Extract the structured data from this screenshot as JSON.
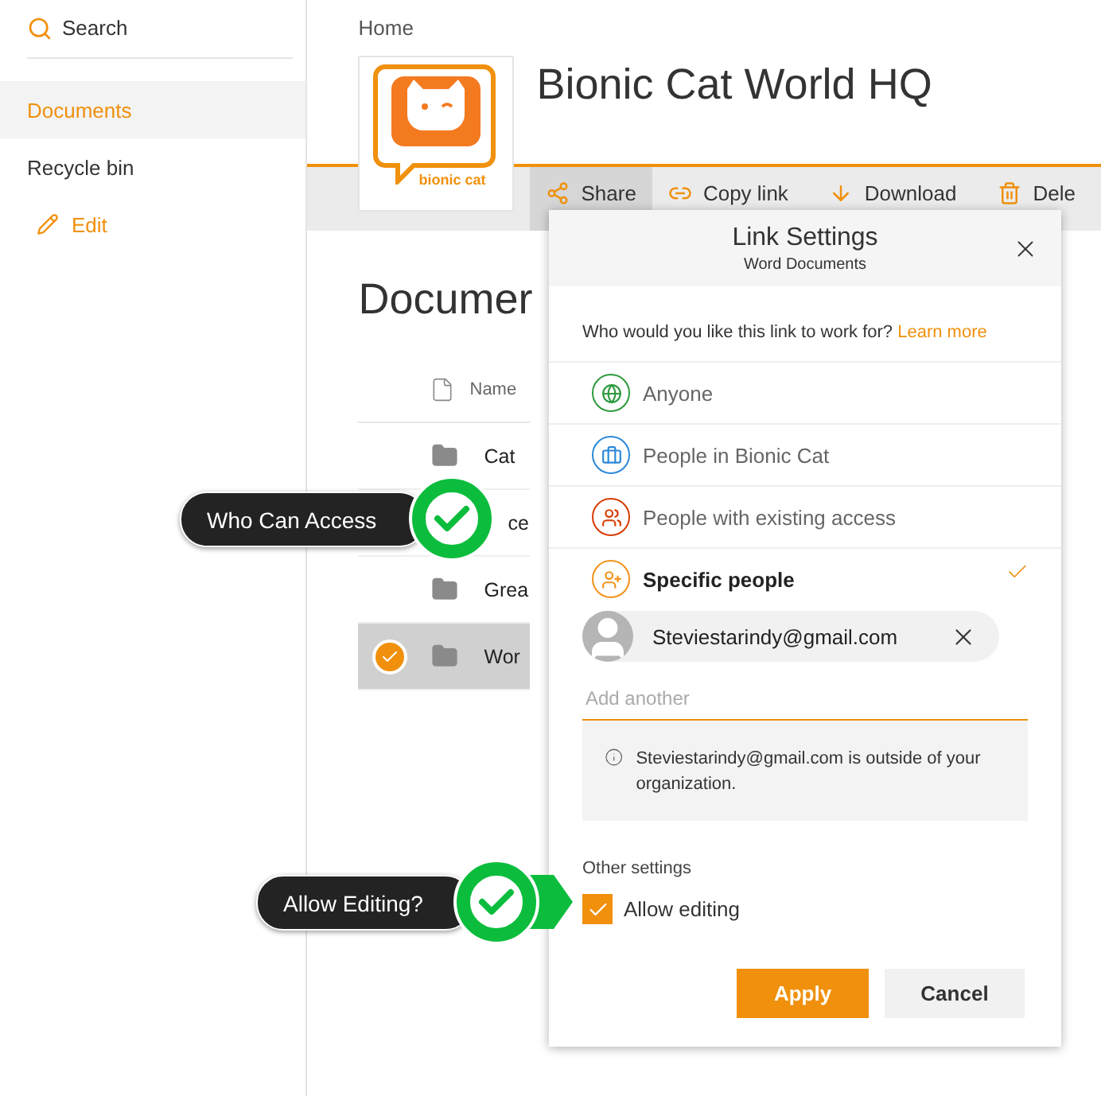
{
  "sidebar": {
    "search": {
      "placeholder": "Search"
    },
    "items": [
      {
        "label": "Documents",
        "kind": "link",
        "selected": true
      },
      {
        "label": "Recycle bin",
        "kind": "link",
        "selected": false
      },
      {
        "label": "Edit",
        "kind": "action",
        "selected": false
      }
    ]
  },
  "breadcrumb": "Home",
  "site": {
    "logo_text": "bionic cat",
    "title": "Bionic Cat World HQ"
  },
  "toolbar": [
    {
      "label": "Share",
      "kind": "share",
      "selected": true
    },
    {
      "label": "Copy link",
      "kind": "link",
      "selected": false
    },
    {
      "label": "Download",
      "kind": "download",
      "selected": false
    },
    {
      "label": "Dele",
      "kind": "delete",
      "selected": false
    }
  ],
  "library": {
    "heading": "Documer",
    "column": "Name",
    "rows": [
      {
        "name": "Cat",
        "kind": "folder",
        "selected": false
      },
      {
        "name": "ce",
        "selected": false
      },
      {
        "name": "Grea",
        "kind": "folder",
        "selected": false
      },
      {
        "name": "Wor",
        "kind": "folder",
        "selected": true
      }
    ]
  },
  "dialog": {
    "title": "Link Settings",
    "subtitle": "Word Documents",
    "question": "Who would you like this link to work for?",
    "learn_more": "Learn more",
    "options": [
      {
        "label": "Anyone",
        "kind": "globe",
        "color": "#2e9a3e",
        "selected": false
      },
      {
        "label": "People in Bionic Cat",
        "kind": "org",
        "color": "#2b88d8",
        "selected": false
      },
      {
        "label": "People with existing access",
        "kind": "existing",
        "color": "#d83b01",
        "selected": false
      },
      {
        "label": "Specific people",
        "kind": "people",
        "color": "#f2921b",
        "selected": true
      }
    ],
    "recipient": "Steviestarindy@gmail.com",
    "add": {
      "placeholder": "Add another"
    },
    "notice": "Steviestarindy@gmail.com is outside of your organization.",
    "other_settings": "Other settings",
    "allow_editing": {
      "label": "Allow editing",
      "checked": true
    },
    "buttons": [
      {
        "label": "Apply",
        "kind": "primary"
      },
      {
        "label": "Cancel",
        "kind": "secondary"
      }
    ]
  },
  "callouts": [
    {
      "text": "Who Can Access"
    },
    {
      "text": "Allow Editing?"
    }
  ]
}
